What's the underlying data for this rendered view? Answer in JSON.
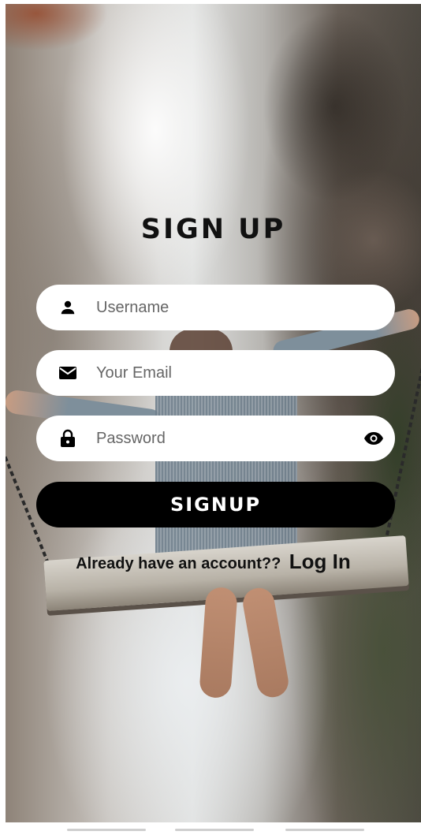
{
  "screen": {
    "title": "SIGN UP"
  },
  "form": {
    "username": {
      "placeholder": "Username",
      "value": ""
    },
    "email": {
      "placeholder": "Your Email",
      "value": ""
    },
    "password": {
      "placeholder": "Password",
      "value": ""
    },
    "submit_label": "SIGNUP"
  },
  "footer": {
    "question": "Already have an account??",
    "login_link": "Log In"
  },
  "icons": {
    "username": "person-icon",
    "email": "mail-icon",
    "password": "lock-icon",
    "toggle_password": "eye-icon"
  },
  "colors": {
    "button_bg": "#000000",
    "button_text": "#ffffff",
    "field_bg": "#ffffff",
    "title": "#111111"
  }
}
